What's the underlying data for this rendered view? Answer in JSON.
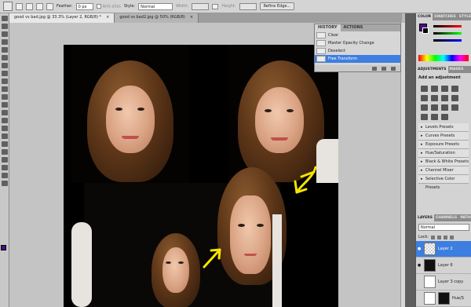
{
  "options_bar": {
    "feather_label": "Feather:",
    "feather_value": "0 px",
    "anti_alias_label": "Anti-alias",
    "style_label": "Style:",
    "style_value": "Normal",
    "width_label": "Width:",
    "height_label": "Height:",
    "refine_edge_button": "Refine Edge..."
  },
  "tabs": [
    {
      "title": "good vs bad.jpg @ 33.3% (Layer 2, RGB/8) *",
      "close": "×"
    },
    {
      "title": "good vs bad2.jpg @ 50% (RGB/8)",
      "close": "×"
    }
  ],
  "history_panel": {
    "tab_history": "HISTORY",
    "tab_actions": "ACTIONS",
    "items": [
      "Clear",
      "Master Opacity Change",
      "Deselect",
      "Free Transform"
    ],
    "selected_index": 3
  },
  "color_panel": {
    "tab_color": "COLOR",
    "tab_swatches": "SWATCHES",
    "tab_styles": "STYLES",
    "foreground": "#4b0f80",
    "background": "#000000"
  },
  "adjustments_panel": {
    "tab_adjustments": "ADJUSTMENTS",
    "tab_masks": "MASKS",
    "title": "Add an adjustment",
    "presets": [
      "Levels Presets",
      "Curves Presets",
      "Exposure Presets",
      "Hue/Saturation Presets",
      "Black & White Presets",
      "Channel Mixer Presets",
      "Selective Color Presets"
    ]
  },
  "layers_panel": {
    "tab_layers": "LAYERS",
    "tab_channels": "CHANNELS",
    "tab_paths": "PATHS",
    "blend_mode": "Normal",
    "lock_label": "Lock:",
    "layers": [
      {
        "name": "Layer 2",
        "selected": true
      },
      {
        "name": "Layer 6",
        "selected": false
      },
      {
        "name": "Layer 3 copy",
        "selected": false
      },
      {
        "name": "Hue/S",
        "selected": false
      }
    ]
  },
  "colors": {
    "accent_selection": "#3d7ee0",
    "annotation_arrow": "#f5e400",
    "foreground_swatch": "#4b0f80"
  }
}
